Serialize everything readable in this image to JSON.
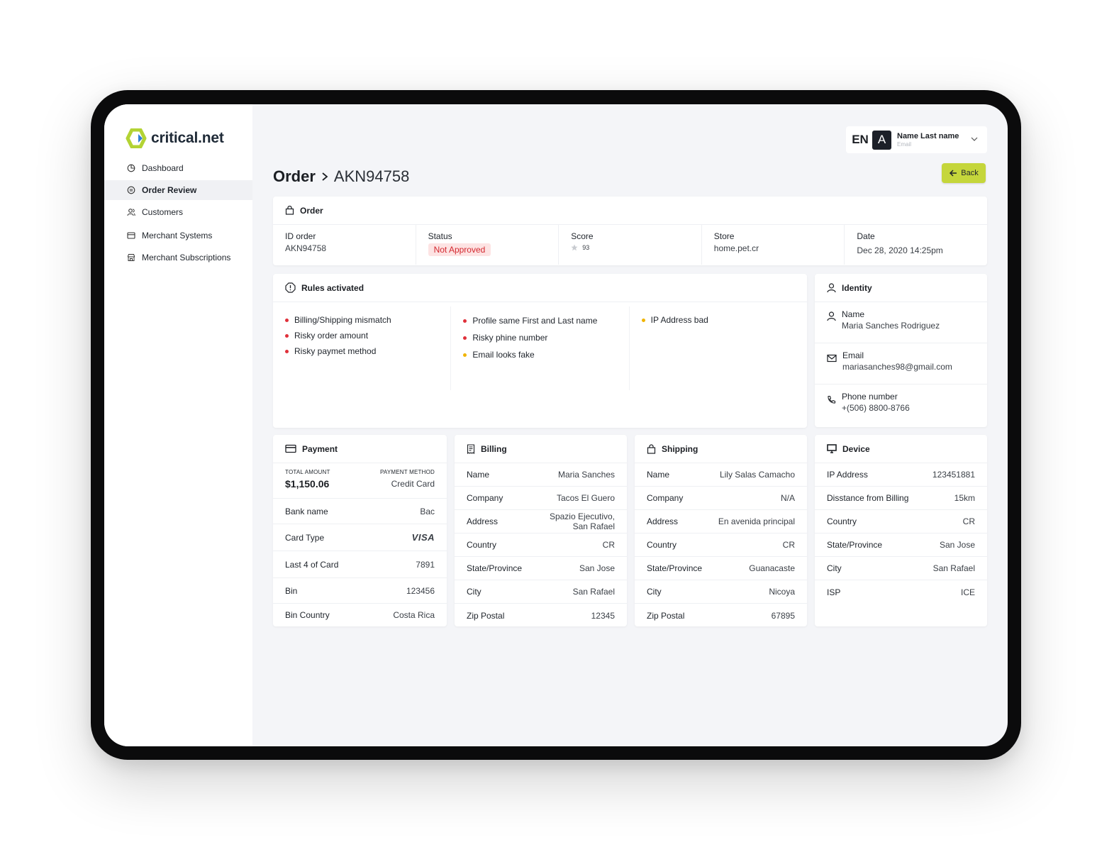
{
  "app": {
    "logo_text": "critical.net"
  },
  "sidebar": {
    "items": [
      {
        "label": "Dashboard",
        "icon": "pie-chart-icon"
      },
      {
        "label": "Order Review",
        "icon": "order-review-icon",
        "active": true
      },
      {
        "label": "Customers",
        "icon": "users-icon"
      },
      {
        "label": "Merchant Systems",
        "icon": "credit-card-icon"
      },
      {
        "label": "Merchant Subscriptions",
        "icon": "store-icon"
      }
    ]
  },
  "header": {
    "language": "EN",
    "user": {
      "initial": "A",
      "name": "Name Last name",
      "email": "Email"
    }
  },
  "page": {
    "title": "Order",
    "order_id": "AKN94758",
    "back_label": "Back"
  },
  "order": {
    "heading": "Order",
    "fields": {
      "id_label": "ID order",
      "id_value": "AKN94758",
      "status_label": "Status",
      "status_value": "Not Approved",
      "score_label": "Score",
      "score_value": "93",
      "store_label": "Store",
      "store_value": "home.pet.cr",
      "date_label": "Date",
      "date_value": "Dec 28, 2020 14:25pm"
    }
  },
  "rules": {
    "heading": "Rules activated",
    "columns": [
      [
        {
          "text": "Billing/Shipping mismatch",
          "level": "high"
        },
        {
          "text": "Risky order amount",
          "level": "high"
        },
        {
          "text": "Risky paymet method",
          "level": "high"
        }
      ],
      [
        {
          "text": "Profile same First and Last name",
          "level": "high"
        },
        {
          "text": "Risky phine number",
          "level": "high"
        },
        {
          "text": "Email looks fake",
          "level": "medium"
        }
      ],
      [
        {
          "text": "IP Address bad",
          "level": "medium"
        }
      ]
    ],
    "colors": {
      "high": "#e0303a",
      "medium": "#f0b400"
    }
  },
  "identity": {
    "heading": "Identity",
    "name_label": "Name",
    "name_value": "Maria Sanches Rodriguez",
    "email_label": "Email",
    "email_value": "mariasanches98@gmail.com",
    "phone_label": "Phone number",
    "phone_value": "+(506) 8800-8766"
  },
  "payment": {
    "heading": "Payment",
    "total_label": "Total Amount",
    "total_value": "$1,150.06",
    "method_label": "Payment Method",
    "method_value": "Credit Card",
    "rows": [
      {
        "k": "Bank name",
        "v": "Bac"
      },
      {
        "k": "Card Type",
        "v": "VISA"
      },
      {
        "k": "Last 4 of Card",
        "v": "7891"
      },
      {
        "k": "Bin",
        "v": "123456"
      },
      {
        "k": "Bin Country",
        "v": "Costa Rica"
      }
    ]
  },
  "billing": {
    "heading": "Billing",
    "rows": [
      {
        "k": "Name",
        "v": "Maria Sanches"
      },
      {
        "k": "Company",
        "v": "Tacos El Guero"
      },
      {
        "k": "Address",
        "v": "Spazio Ejecutivo, San Rafael"
      },
      {
        "k": "Country",
        "v": "CR"
      },
      {
        "k": "State/Province",
        "v": "San Jose"
      },
      {
        "k": "City",
        "v": "San Rafael"
      },
      {
        "k": "Zip Postal",
        "v": "12345"
      }
    ]
  },
  "shipping": {
    "heading": "Shipping",
    "rows": [
      {
        "k": "Name",
        "v": "Lily Salas Camacho"
      },
      {
        "k": "Company",
        "v": "N/A"
      },
      {
        "k": "Address",
        "v": "En avenida principal"
      },
      {
        "k": "Country",
        "v": "CR"
      },
      {
        "k": "State/Province",
        "v": "Guanacaste"
      },
      {
        "k": "City",
        "v": "Nicoya"
      },
      {
        "k": "Zip Postal",
        "v": "67895"
      }
    ]
  },
  "device": {
    "heading": "Device",
    "rows": [
      {
        "k": "IP Address",
        "v": "123451881"
      },
      {
        "k": "Disstance from Billing",
        "v": "15km"
      },
      {
        "k": "Country",
        "v": "CR"
      },
      {
        "k": "State/Province",
        "v": "San Jose"
      },
      {
        "k": "City",
        "v": "San Rafael"
      },
      {
        "k": "ISP",
        "v": "ICE"
      }
    ]
  },
  "theme": {
    "accent": "#c5d63b",
    "logo_green": "#b3d334",
    "logo_blue": "#2f7fd8"
  }
}
